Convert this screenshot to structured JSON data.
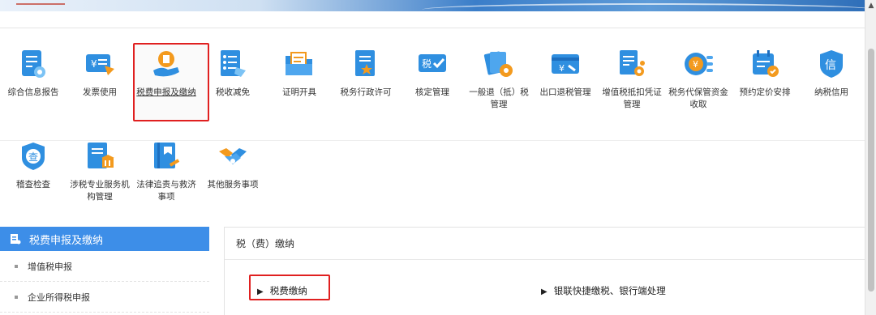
{
  "banner": {
    "ribbon_text": ""
  },
  "tiles_row1": [
    {
      "label": "综合信息报告",
      "icon": "report-icon"
    },
    {
      "label": "发票使用",
      "icon": "invoice-icon"
    },
    {
      "label": "税费申报及缴纳",
      "icon": "tax-declare-icon",
      "active": true
    },
    {
      "label": "税收减免",
      "icon": "tax-relief-icon"
    },
    {
      "label": "证明开具",
      "icon": "certificate-icon"
    },
    {
      "label": "税务行政许可",
      "icon": "license-icon"
    },
    {
      "label": "核定管理",
      "icon": "approval-icon"
    },
    {
      "label": "一般退（抵）税管理",
      "icon": "refund-icon"
    },
    {
      "label": "出口退税管理",
      "icon": "export-refund-icon"
    },
    {
      "label": "增值税抵扣凭证管理",
      "icon": "vat-voucher-icon"
    },
    {
      "label": "税务代保管资金收取",
      "icon": "custody-funds-icon"
    },
    {
      "label": "预约定价安排",
      "icon": "pricing-schedule-icon"
    },
    {
      "label": "纳税信用",
      "icon": "credit-icon"
    }
  ],
  "tiles_row2": [
    {
      "label": "稽查检查",
      "icon": "inspection-icon"
    },
    {
      "label": "涉税专业服务机构管理",
      "icon": "agency-icon"
    },
    {
      "label": "法律追责与救济事项",
      "icon": "legal-icon"
    },
    {
      "label": "其他服务事项",
      "icon": "handshake-icon"
    }
  ],
  "sidebar": {
    "title": "税费申报及缴纳",
    "items": [
      "增值税申报",
      "企业所得税申报"
    ]
  },
  "panel": {
    "title": "税（费）缴纳",
    "links": [
      {
        "tri": "▶",
        "label": "税费缴纳"
      },
      {
        "tri": "▶",
        "label": "银联快捷缴税、银行端处理"
      }
    ]
  },
  "colors": {
    "accent": "#3d8ee8",
    "highlight_border": "#e02020",
    "icon_blue": "#2f8fe0",
    "icon_orange": "#f39a1e"
  }
}
